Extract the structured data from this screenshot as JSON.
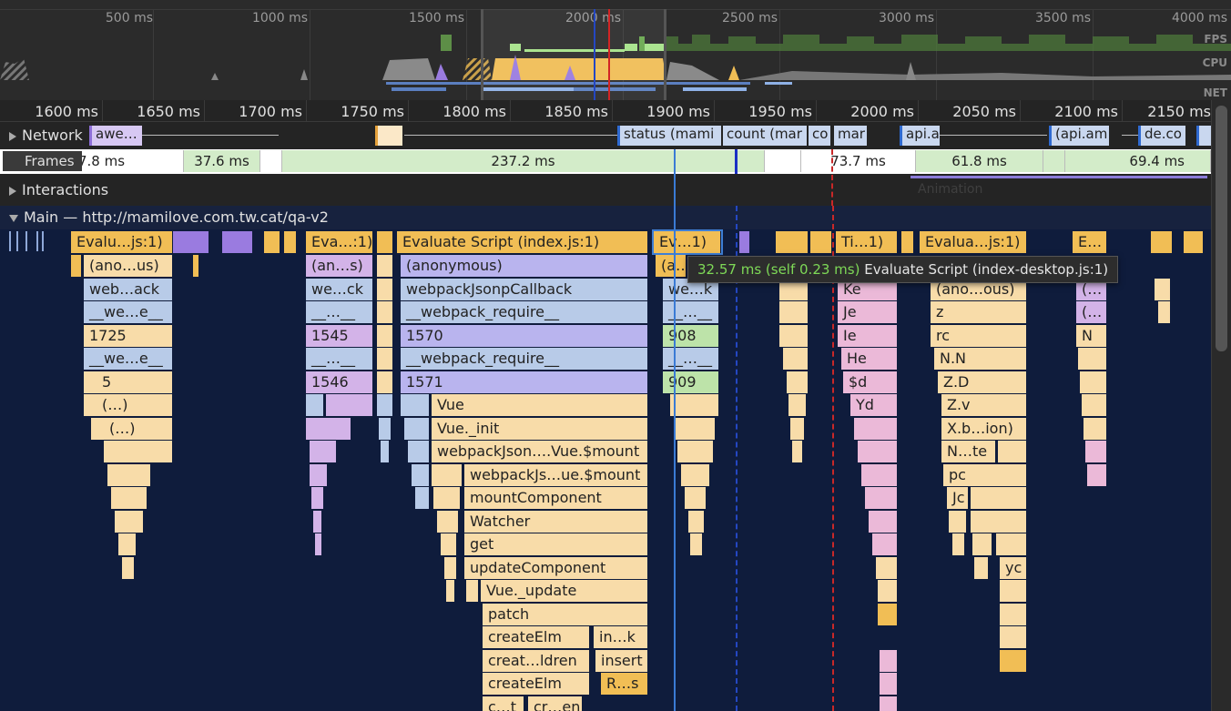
{
  "overview": {
    "ticks": [
      "500 ms",
      "1000 ms",
      "1500 ms",
      "2000 ms",
      "2500 ms",
      "3000 ms",
      "3500 ms",
      "4000 ms"
    ],
    "labels": {
      "fps": "FPS",
      "cpu": "CPU",
      "net": "NET"
    }
  },
  "ruler": {
    "ticks": [
      "1600 ms",
      "1650 ms",
      "1700 ms",
      "1750 ms",
      "1800 ms",
      "1850 ms",
      "1900 ms",
      "1950 ms",
      "2000 ms",
      "2050 ms",
      "2100 ms",
      "2150 ms"
    ]
  },
  "tracks": {
    "network": {
      "label": "Network",
      "requests": [
        "awe…",
        "status (mami",
        "count (mar",
        "co",
        "mar",
        "api.a",
        "(api.am",
        "de.co"
      ]
    },
    "frames": {
      "label": "Frames",
      "items": [
        "7.8 ms",
        "37.6 ms",
        "",
        "237.2 ms",
        "",
        "73.7 ms",
        "61.8 ms",
        "",
        "69.4 ms"
      ]
    },
    "interactions": {
      "label": "Interactions",
      "animation_label": "Animation"
    },
    "main": {
      "label": "Main — http://mamilove.com.tw.cat/qa-v2"
    }
  },
  "flame": [
    [
      "Evalu…js:1)",
      "Eva…:1)",
      "Evaluate Script (index.js:1)",
      "Ev…1)",
      "Ti…1)",
      "Evalua…js:1)",
      "E…"
    ],
    [
      "(ano…us)",
      "(an…s)",
      "(anonymous)",
      "(a…"
    ],
    [
      "web…ack",
      "we…ck",
      "webpackJsonpCallback",
      "we…k",
      "Ke",
      "(ano…ous)",
      "(…"
    ],
    [
      "__we…e__",
      "__…__",
      "__webpack_require__",
      "__…__",
      "Je",
      "z",
      "(…"
    ],
    [
      "1725",
      "1545",
      "1570",
      "908",
      "Ie",
      "rc",
      "N"
    ],
    [
      "__we…e__",
      "__…__",
      "__webpack_require__",
      "__…__",
      "He",
      "N.N"
    ],
    [
      "5",
      "1546",
      "1571",
      "909",
      "$d",
      "Z.D"
    ],
    [
      "(…)",
      "Vue",
      "Yd",
      "Z.v"
    ],
    [
      "(…)",
      "Vue._init",
      "X.b…ion)"
    ],
    [
      "webpackJson….Vue.$mount",
      "N…te"
    ],
    [
      "webpackJs…ue.$mount",
      "pc"
    ],
    [
      "mountComponent",
      "Jc"
    ],
    [
      "Watcher"
    ],
    [
      "get"
    ],
    [
      "updateComponent"
    ],
    [
      "Vue._update",
      "yc"
    ],
    [
      "patch"
    ],
    [
      "createElm",
      "in…k"
    ],
    [
      "creat…ldren",
      "insert"
    ],
    [
      "createElm",
      "R…s"
    ],
    [
      "c…t",
      "cr…en"
    ]
  ],
  "tooltip": {
    "time": "32.57 ms (self 0.23 ms)",
    "name": "Evaluate Script (index-desktop.js:1)"
  }
}
